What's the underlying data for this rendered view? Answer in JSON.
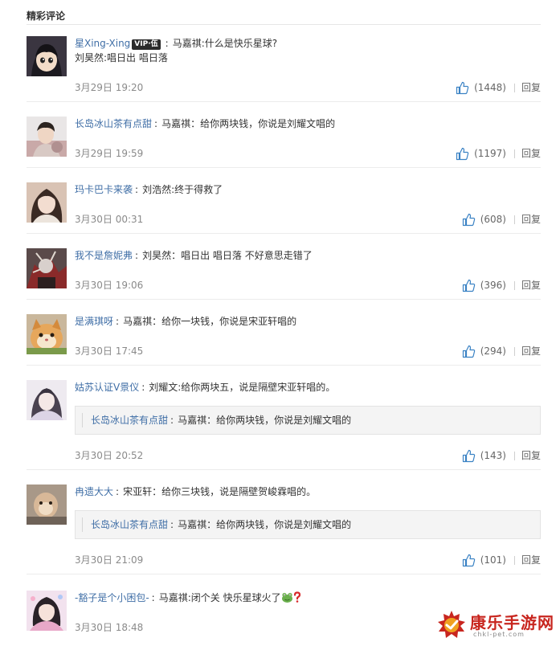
{
  "section_title": "精彩评论",
  "comments": [
    {
      "user": "星Xing-Xing",
      "vip": "VIP·伍",
      "text": "马嘉祺:什么是快乐星球?",
      "text2": "刘昊然:唱日出 唱日落",
      "time": "3月29日 19:20",
      "likes": "(1448)",
      "reply": "回复"
    },
    {
      "user": "长岛冰山茶有点甜",
      "text": "马嘉祺：给你两块钱，你说是刘耀文唱的",
      "time": "3月29日 19:59",
      "likes": "(1197)",
      "reply": "回复"
    },
    {
      "user": "玛卡巴卡来袭",
      "text": "刘浩然:终于得救了",
      "time": "3月30日 00:31",
      "likes": "(608)",
      "reply": "回复"
    },
    {
      "user": "我不是詹妮弗",
      "text": "刘昊然：唱日出 唱日落 不好意思走错了",
      "time": "3月30日 19:06",
      "likes": "(396)",
      "reply": "回复"
    },
    {
      "user": "是满琪呀",
      "text": "马嘉祺：给你一块钱，你说是宋亚轩唱的",
      "time": "3月30日 17:45",
      "likes": "(294)",
      "reply": "回复"
    },
    {
      "user": "姑苏认证V景仪",
      "text": "刘耀文:给你两块五，说是隔壁宋亚轩唱的。",
      "quote_user": "长岛冰山茶有点甜",
      "quote_text": "马嘉祺：给你两块钱，你说是刘耀文唱的",
      "time": "3月30日 20:52",
      "likes": "(143)",
      "reply": "回复"
    },
    {
      "user": "冉遗大大",
      "text": "宋亚轩：给你三块钱，说是隔壁贺峻霖唱的。",
      "quote_user": "长岛冰山茶有点甜",
      "quote_text": "马嘉祺：给你两块钱，你说是刘耀文唱的",
      "time": "3月30日 21:09",
      "likes": "(101)",
      "reply": "回复"
    },
    {
      "user": "-豁子是个小困包-",
      "text": "马嘉祺:闭个关 快乐星球火了",
      "time": "3月30日 18:48"
    }
  ],
  "watermark": {
    "name": "康乐手游网",
    "url": "chkl-pet.com"
  },
  "colors": {
    "link": "#3f6ea6",
    "like_icon": "#3a82c4",
    "watermark": "#c8261f"
  }
}
